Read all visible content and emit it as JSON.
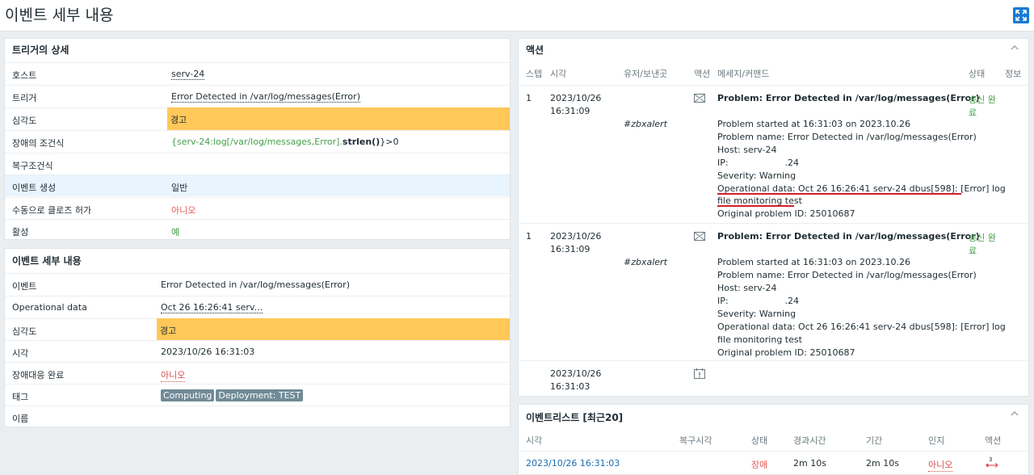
{
  "page_title": "이벤트 세부 내용",
  "trigger_panel": {
    "title": "트리거의 상세",
    "rows": [
      {
        "label": "호스트",
        "value": "serv-24"
      },
      {
        "label": "트리거",
        "value": "Error Detected in /var/log/messages(Error)"
      },
      {
        "label": "심각도",
        "value": "경고"
      },
      {
        "label": "장애의 조건식",
        "value_part1": "{serv-24:log[/var/log/messages,Error].",
        "value_part2": "strlen()",
        "value_part3": "}>0"
      },
      {
        "label": "복구조건식",
        "value": ""
      },
      {
        "label": "이벤트 생성",
        "value": "일반"
      },
      {
        "label": "수동으로 클로즈 허가",
        "value": "아니오"
      },
      {
        "label": "활성",
        "value": "예"
      }
    ]
  },
  "event_panel": {
    "title": "이벤트 세부 내용",
    "rows": [
      {
        "label": "이벤트",
        "value": "Error Detected in /var/log/messages(Error)"
      },
      {
        "label": "Operational data",
        "value": "Oct 26 16:26:41 serv..."
      },
      {
        "label": "심각도",
        "value": "경고"
      },
      {
        "label": "시각",
        "value": "2023/10/26 16:31:03"
      },
      {
        "label": "장애대응 완료",
        "value": "아니오"
      },
      {
        "label": "태그",
        "tags": [
          "Computing",
          "Deployment: TEST"
        ]
      },
      {
        "label": "이름",
        "value": ""
      }
    ]
  },
  "actions_panel": {
    "title": "액션",
    "columns": [
      "스텝",
      "시각",
      "유저/보낸곳",
      "액션",
      "메세지/커맨드",
      "상태",
      "정보"
    ],
    "entries": [
      {
        "step": "1",
        "date": "2023/10/26",
        "time": "16:31:09",
        "recipient": "#zbxalert",
        "action_icon": "envelope-icon",
        "subject": "Problem: Error Detected in /var/log/messages(Error)",
        "lines": [
          "Problem started at 16:31:03 on 2023.10.26",
          "Problem name: Error Detected in /var/log/messages(Error)",
          "Host: serv-24",
          "IP:                    .24",
          "Severity: Warning",
          "Operational data: Oct 26 16:26:41 serv-24 dbus[598]: [Error] log",
          "file monitoring test",
          "Original problem ID: 25010687"
        ],
        "status_1": "송신 완",
        "status_2": "료"
      },
      {
        "step": "1",
        "date": "2023/10/26",
        "time": "16:31:09",
        "recipient": "#zbxalert",
        "action_icon": "envelope-icon",
        "subject": "Problem: Error Detected in /var/log/messages(Error)",
        "lines": [
          "Problem started at 16:31:03 on 2023.10.26",
          "Problem name: Error Detected in /var/log/messages(Error)",
          "Host: serv-24",
          "IP:                    .24",
          "Severity: Warning",
          "Operational data: Oct 26 16:26:41 serv-24 dbus[598]: [Error] log",
          "file monitoring test",
          "Original problem ID: 25010687"
        ],
        "status_1": "송신 완",
        "status_2": "료"
      },
      {
        "step": "",
        "date": "2023/10/26",
        "time": "16:31:03",
        "recipient": "",
        "action_icon": "calendar-alert-icon"
      }
    ]
  },
  "events_list_panel": {
    "title": "이벤트리스트 [최근20]",
    "columns": [
      "시각",
      "복구시각",
      "상태",
      "경과시간",
      "기간",
      "인지",
      "액션"
    ],
    "rows": [
      {
        "time": "2023/10/26 16:31:03",
        "recovery_time": "",
        "status": "장애",
        "age": "2m 10s",
        "duration": "2m 10s",
        "ack": "아니오",
        "action_count": "3"
      }
    ]
  },
  "colors": {
    "warning": "#ffc859",
    "accent": "#1a7ad4",
    "problem_red": "#e45959",
    "ok_green": "#429e47"
  }
}
